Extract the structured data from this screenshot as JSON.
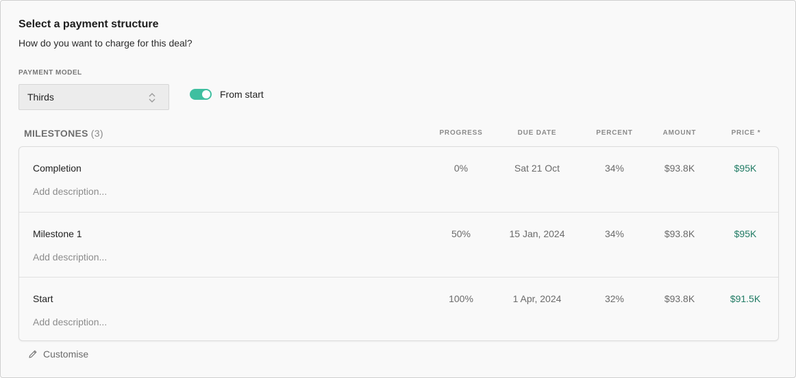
{
  "header": {
    "title": "Select a payment structure",
    "subtitle": "How do you want to charge for this deal?"
  },
  "payment_model": {
    "label": "PAYMENT MODEL",
    "selected": "Thirds"
  },
  "toggle": {
    "label": "From start",
    "on": true
  },
  "milestones": {
    "title": "MILESTONES",
    "count": "(3)",
    "columns": {
      "progress": "PROGRESS",
      "due_date": "DUE DATE",
      "percent": "PERCENT",
      "amount": "AMOUNT",
      "price": "PRICE *"
    },
    "rows": [
      {
        "name": "Completion",
        "description": "Add description...",
        "progress": "0%",
        "due_date": "Sat 21 Oct",
        "percent": "34%",
        "amount": "$93.8K",
        "price": "$95K"
      },
      {
        "name": "Milestone 1",
        "description": "Add description...",
        "progress": "50%",
        "due_date": "15 Jan, 2024",
        "percent": "34%",
        "amount": "$93.8K",
        "price": "$95K"
      },
      {
        "name": "Start",
        "description": "Add description...",
        "progress": "100%",
        "due_date": "1 Apr, 2024",
        "percent": "32%",
        "amount": "$93.8K",
        "price": "$91.5K"
      }
    ]
  },
  "footer": {
    "customise_label": "Customise",
    "customise_icon": "pencil-icon"
  },
  "colors": {
    "accent": "#3fbfa0",
    "price_text": "#1f7a63"
  }
}
